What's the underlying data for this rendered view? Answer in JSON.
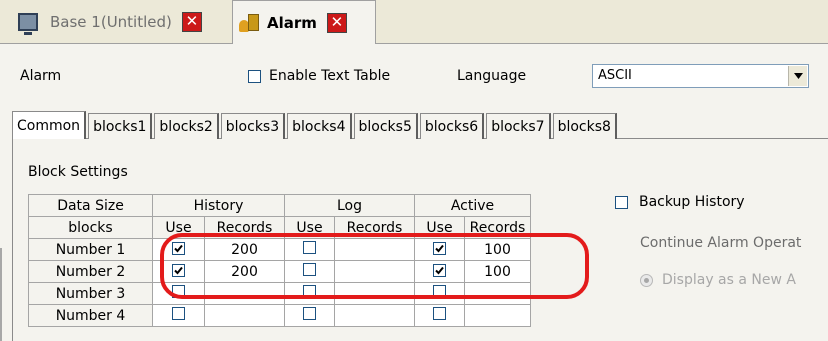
{
  "doc_tabs": [
    {
      "label": "Base 1(Untitled)",
      "active": false
    },
    {
      "label": "Alarm",
      "active": true
    }
  ],
  "header": {
    "alarm_label": "Alarm",
    "enable_text_table_label": "Enable Text Table",
    "enable_text_table_checked": false,
    "language_label": "Language",
    "language_value": "ASCII"
  },
  "tabs": [
    "Common",
    "blocks1",
    "blocks2",
    "blocks3",
    "blocks4",
    "blocks5",
    "blocks6",
    "blocks7",
    "blocks8"
  ],
  "active_tab": "Common",
  "block_settings": {
    "title": "Block Settings",
    "col_groups": [
      "Data Size",
      "History",
      "Log",
      "Active"
    ],
    "sub_headers": [
      "blocks",
      "Use",
      "Records",
      "Use",
      "Records",
      "Use",
      "Records"
    ],
    "rows": [
      {
        "name": "Number 1",
        "history_use": true,
        "history_records": "200",
        "log_use": false,
        "log_records": "",
        "active_use": true,
        "active_records": "100"
      },
      {
        "name": "Number 2",
        "history_use": true,
        "history_records": "200",
        "log_use": false,
        "log_records": "",
        "active_use": true,
        "active_records": "100"
      },
      {
        "name": "Number 3",
        "history_use": false,
        "history_records": "",
        "log_use": false,
        "log_records": "",
        "active_use": false,
        "active_records": ""
      },
      {
        "name": "Number 4",
        "history_use": false,
        "history_records": "",
        "log_use": false,
        "log_records": "",
        "active_use": false,
        "active_records": ""
      }
    ]
  },
  "backup": {
    "label": "Backup History",
    "checked": false,
    "continue_label": "Continue Alarm Operat",
    "display_option": "Display as a New A"
  },
  "colors": {
    "highlight": "#e31b1b",
    "close": "#cc1919",
    "background": "#ece9d8"
  }
}
